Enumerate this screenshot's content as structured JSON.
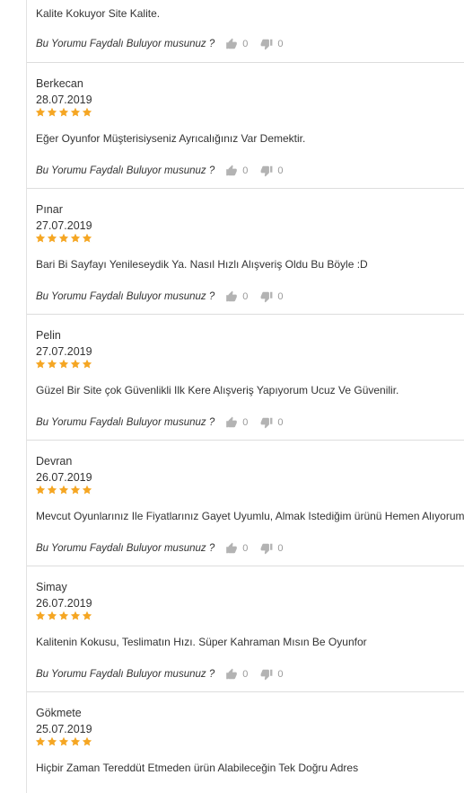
{
  "helpful_question": "Bu Yorumu Faydalı Buluyor musunuz ?",
  "colors": {
    "star": "#f5a623",
    "vote_icon": "#b3b3b3",
    "divider": "#dddddd",
    "text": "#333333"
  },
  "reviews": [
    {
      "comment": "Kalite Kokuyor Site Kalite.",
      "likes": "0",
      "dislikes": "0"
    },
    {
      "author": "Berkecan",
      "date": "28.07.2019",
      "rating": 5,
      "comment": "Eğer Oyunfor Müşterisiyseniz Ayrıcalığınız Var Demektir.",
      "likes": "0",
      "dislikes": "0"
    },
    {
      "author": "Pınar",
      "date": "27.07.2019",
      "rating": 5,
      "comment": "Bari Bi Sayfayı Yenileseydik Ya. Nasıl Hızlı Alışveriş Oldu Bu Böyle :D",
      "likes": "0",
      "dislikes": "0"
    },
    {
      "author": "Pelin",
      "date": "27.07.2019",
      "rating": 5,
      "comment": "Güzel Bir Site çok Güvenlikli Ilk Kere Alışveriş Yapıyorum Ucuz Ve Güvenilir.",
      "likes": "0",
      "dislikes": "0"
    },
    {
      "author": "Devran",
      "date": "26.07.2019",
      "rating": 5,
      "comment": "Mevcut Oyunlarınız Ile Fiyatlarınız Gayet Uyumlu, Almak Istediğim ürünü Hemen Alıyorum.",
      "likes": "0",
      "dislikes": "0"
    },
    {
      "author": "Simay",
      "date": "26.07.2019",
      "rating": 5,
      "comment": "Kalitenin Kokusu, Teslimatın Hızı. Süper Kahraman Mısın Be Oyunfor",
      "likes": "0",
      "dislikes": "0"
    },
    {
      "author": "Gökmete",
      "date": "25.07.2019",
      "rating": 5,
      "comment": "Hiçbir Zaman Tereddüt Etmeden ürün Alabileceğin Tek Doğru Adres"
    }
  ]
}
